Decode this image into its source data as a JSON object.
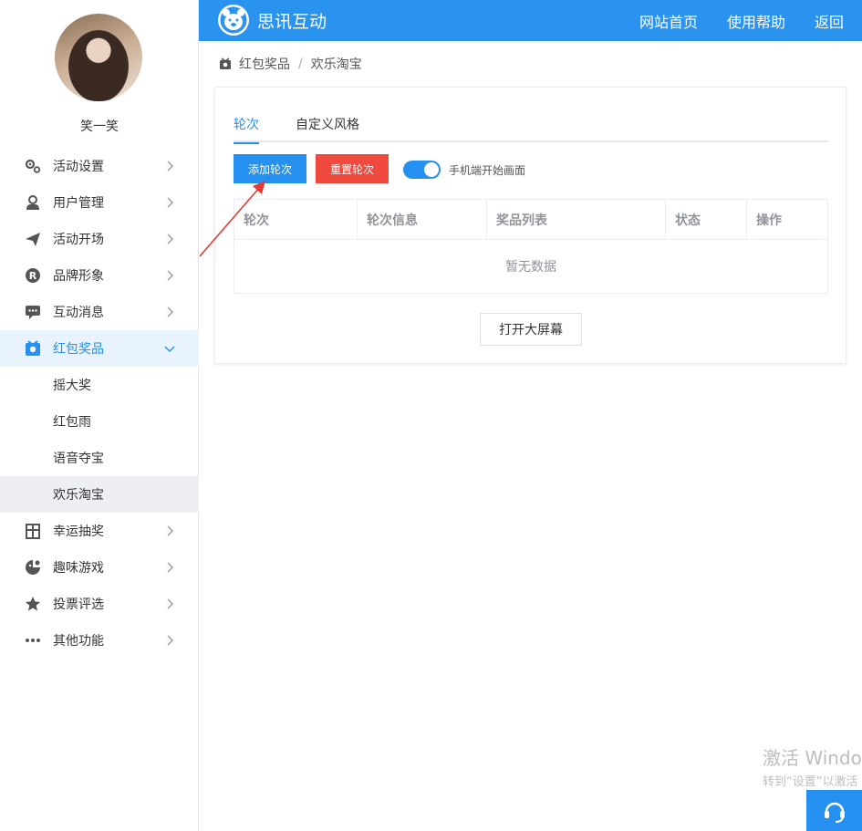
{
  "header": {
    "brand": "思讯互动",
    "nav": [
      {
        "label": "网站首页"
      },
      {
        "label": "使用帮助"
      },
      {
        "label": "返回"
      }
    ],
    "bg_color": "#2a93ef"
  },
  "sidebar": {
    "username": "笑一笑",
    "items": [
      {
        "label": "活动设置",
        "icon": "gears-icon"
      },
      {
        "label": "用户管理",
        "icon": "user-manage-icon"
      },
      {
        "label": "活动开场",
        "icon": "paper-plane-icon"
      },
      {
        "label": "品牌形象",
        "icon": "registered-icon"
      },
      {
        "label": "互动消息",
        "icon": "message-icon"
      },
      {
        "label": "红包奖品",
        "icon": "gift-icon",
        "expanded": true
      },
      {
        "label": "幸运抽奖",
        "icon": "lottery-icon"
      },
      {
        "label": "趣味游戏",
        "icon": "game-icon"
      },
      {
        "label": "投票评选",
        "icon": "star-icon"
      },
      {
        "label": "其他功能",
        "icon": "more-icon"
      }
    ],
    "submenu": [
      {
        "label": "摇大奖"
      },
      {
        "label": "红包雨"
      },
      {
        "label": "语音夺宝"
      },
      {
        "label": "欢乐淘宝",
        "current": true
      }
    ],
    "active_color": "#2590ef"
  },
  "breadcrumb": {
    "section": "红包奖品",
    "separator": "/",
    "page": "欢乐淘宝"
  },
  "main": {
    "tabs": [
      {
        "label": "轮次",
        "active": true
      },
      {
        "label": "自定义风格"
      }
    ],
    "add_button": "添加轮次",
    "reset_button": "重置轮次",
    "toggle": {
      "label": "手机端开始画面",
      "on": true
    },
    "table": {
      "columns": [
        "轮次",
        "轮次信息",
        "奖品列表",
        "状态",
        "操作"
      ],
      "empty_text": "暂无数据"
    },
    "big_screen_button": "打开大屏幕"
  },
  "watermark": {
    "line1": "激活 Windo",
    "line2": "转到“设置”以激活"
  },
  "colors": {
    "primary": "#2590ef",
    "danger": "#f04a3f",
    "annotation": "#e53935"
  }
}
